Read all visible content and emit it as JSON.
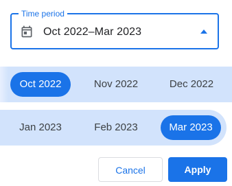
{
  "time_period": {
    "label": "Time period",
    "value": "Oct 2022–Mar 2023",
    "icon": "calendar-icon",
    "dropdown_icon": "arrow-drop-up-icon"
  },
  "months": {
    "row1": [
      {
        "label": "Oct 2022",
        "selected": true
      },
      {
        "label": "Nov 2022",
        "selected": false
      },
      {
        "label": "Dec 2022",
        "selected": false
      }
    ],
    "row2": [
      {
        "label": "Jan 2023",
        "selected": false
      },
      {
        "label": "Feb 2023",
        "selected": false
      },
      {
        "label": "Mar 2023",
        "selected": true
      }
    ]
  },
  "actions": {
    "cancel_label": "Cancel",
    "apply_label": "Apply"
  },
  "colors": {
    "accent": "#1a73e8",
    "range_highlight": "#d2e3fc",
    "text": "#3c4043"
  }
}
